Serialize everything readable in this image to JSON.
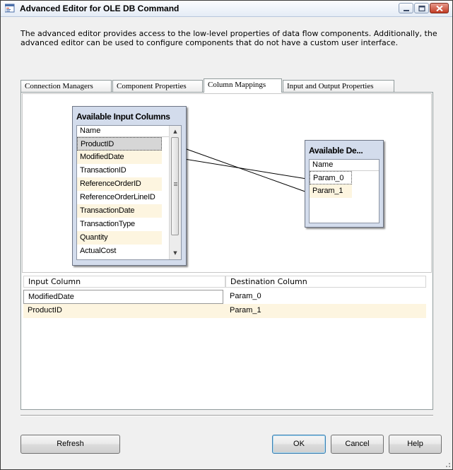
{
  "window": {
    "title": "Advanced Editor for OLE DB Command"
  },
  "description": "The advanced editor provides access to the low-level properties of data flow components. Additionally, the advanced editor can be used to configure components that do not have a custom user interface.",
  "tabs": [
    {
      "label": "Connection Managers"
    },
    {
      "label": "Component Properties"
    },
    {
      "label": "Column Mappings",
      "active": true
    },
    {
      "label": "Input and Output Properties"
    }
  ],
  "input_table": {
    "title": "Available Input Columns",
    "column_header": "Name",
    "rows": [
      "ProductID",
      "ModifiedDate",
      "TransactionID",
      "ReferenceOrderID",
      "ReferenceOrderLineID",
      "TransactionDate",
      "TransactionType",
      "Quantity",
      "ActualCost"
    ]
  },
  "dest_table": {
    "title": "Available De...",
    "column_header": "Name",
    "rows": [
      "Param_0",
      "Param_1"
    ]
  },
  "mapping_grid": {
    "headers": [
      "Input Column",
      "Destination Column"
    ],
    "rows": [
      {
        "input": "ModifiedDate",
        "destination": "Param_0"
      },
      {
        "input": "ProductID",
        "destination": "Param_1"
      }
    ]
  },
  "buttons": {
    "refresh": "Refresh",
    "ok": "OK",
    "cancel": "Cancel",
    "help": "Help"
  },
  "colors": {
    "table_header_bg": "#d3dcec",
    "alt_row": "#fdf5e0",
    "selected_row": "#d6d6d6",
    "close_button": "#c23c25"
  }
}
